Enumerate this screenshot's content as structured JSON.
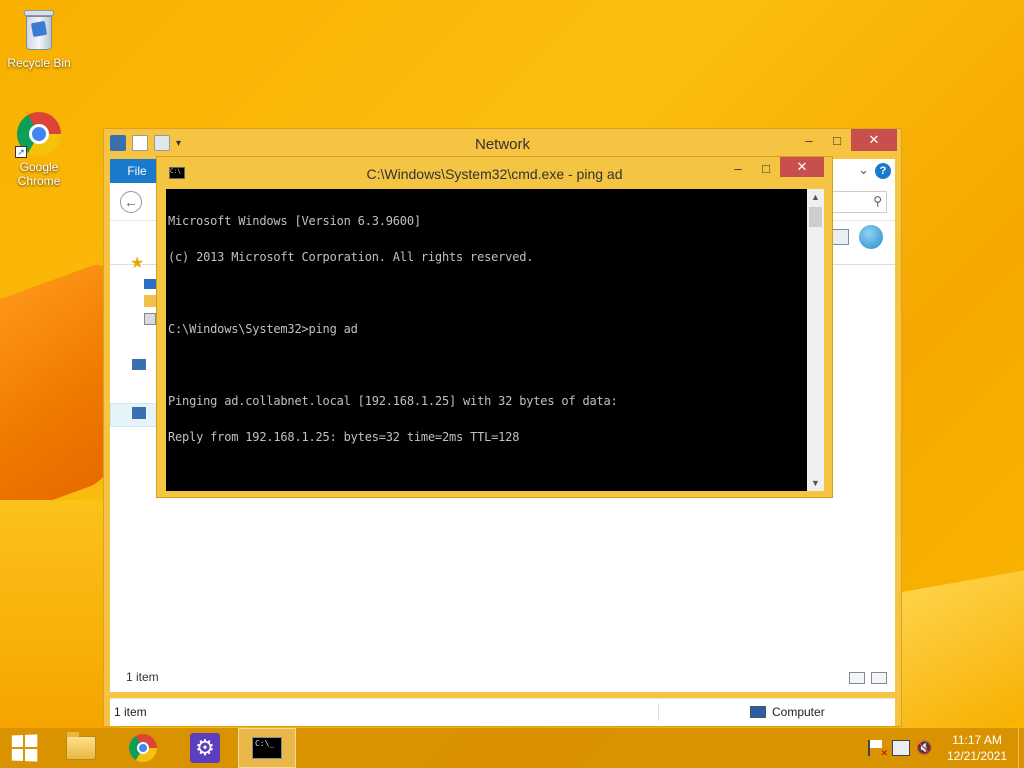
{
  "desktop": {
    "icons": [
      {
        "label": "Recycle Bin",
        "icon": "recycle-bin-icon"
      },
      {
        "label": "Google Chrome",
        "icon": "chrome-icon"
      }
    ]
  },
  "explorer": {
    "title": "Network",
    "file_tab": "File",
    "help": "?",
    "status_inner": "1 item",
    "status_left": "1 item",
    "status_location": "Computer",
    "window_buttons": {
      "minimize": "–",
      "maximize": "□",
      "close": "✕"
    }
  },
  "cmd": {
    "title": "C:\\Windows\\System32\\cmd.exe - ping  ad",
    "icon_text": "C:\\",
    "lines": [
      "Microsoft Windows [Version 6.3.9600]",
      "(c) 2013 Microsoft Corporation. All rights reserved.",
      "",
      "C:\\Windows\\System32>ping ad",
      "",
      "Pinging ad.collabnet.local [192.168.1.25] with 32 bytes of data:",
      "Reply from 192.168.1.25: bytes=32 time=2ms TTL=128"
    ],
    "window_buttons": {
      "minimize": "–",
      "maximize": "□",
      "close": "✕"
    }
  },
  "taskbar": {
    "apps": [
      {
        "name": "File Explorer",
        "icon": "folder-icon"
      },
      {
        "name": "Google Chrome",
        "icon": "chrome-icon"
      },
      {
        "name": "Settings",
        "icon": "gear-icon"
      },
      {
        "name": "Command Prompt",
        "icon": "cmd-icon",
        "active": true
      }
    ],
    "cmd_icon_text": "C:\\_",
    "time": "11:17 AM",
    "date": "12/21/2021"
  }
}
